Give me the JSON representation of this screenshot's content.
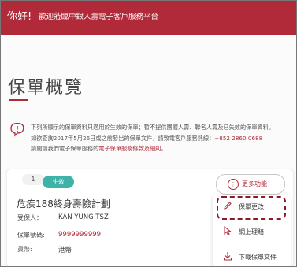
{
  "header": {
    "greeting": "你好!",
    "subtitle": "歡迎蒞臨中銀人壽電子客戶服務平台"
  },
  "page": {
    "title": "保單概覽"
  },
  "notice": {
    "line1": "下列所顯示的保單資料只適用於生效的保單；暫不提供團體人壽、聯名人壽及已失效的保單資料。",
    "line2": "如欲查詢2017年5月26日或之前發出的保單文件，請致電客戶服務熱線：",
    "hotline": "+852 2860 0688",
    "line3_prefix": "請閱讀我們電子保單服務的",
    "terms_link": "電子保單服務條款及細則",
    "line3_suffix": "。"
  },
  "policy_card": {
    "index": "1",
    "status": "生效",
    "more_label": "更多功能",
    "plan_name": "危疾188終身壽險計劃",
    "insured_label": "受保人：",
    "insured_value": "KAN YUNG TSZ",
    "policy_no_label": "保單號碼:",
    "policy_no_value": "9999999999",
    "currency_label": "貨幣:",
    "currency_value": "港幣"
  },
  "menu": {
    "items": [
      {
        "label": "保單更改",
        "icon": "pencil-icon"
      },
      {
        "label": "網上理賠",
        "icon": "cursor-icon"
      },
      {
        "label": "下載保單文件",
        "icon": "download-icon"
      }
    ]
  },
  "colors": {
    "brand": "#b02a39",
    "status_green": "#3fb2a8"
  }
}
